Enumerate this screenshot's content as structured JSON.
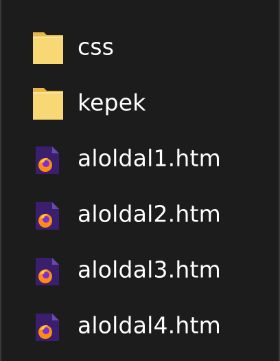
{
  "file_list": {
    "items": [
      {
        "name": "css",
        "type": "folder",
        "icon": "folder-icon"
      },
      {
        "name": "kepek",
        "type": "folder",
        "icon": "folder-icon"
      },
      {
        "name": "aloldal1.htm",
        "type": "file",
        "icon": "firefox-html-file-icon"
      },
      {
        "name": "aloldal2.htm",
        "type": "file",
        "icon": "firefox-html-file-icon"
      },
      {
        "name": "aloldal3.htm",
        "type": "file",
        "icon": "firefox-html-file-icon"
      },
      {
        "name": "aloldal4.htm",
        "type": "file",
        "icon": "firefox-html-file-icon"
      }
    ]
  },
  "colors": {
    "background": "#1c1c1c",
    "text": "#ffffff",
    "folder": "#f8d775",
    "folder_dark": "#e8b949",
    "file_page": "#3a1f6e",
    "file_fold": "#6a4aa8",
    "firefox_orange": "#ff8a16",
    "firefox_purple": "#7b2fd6"
  }
}
